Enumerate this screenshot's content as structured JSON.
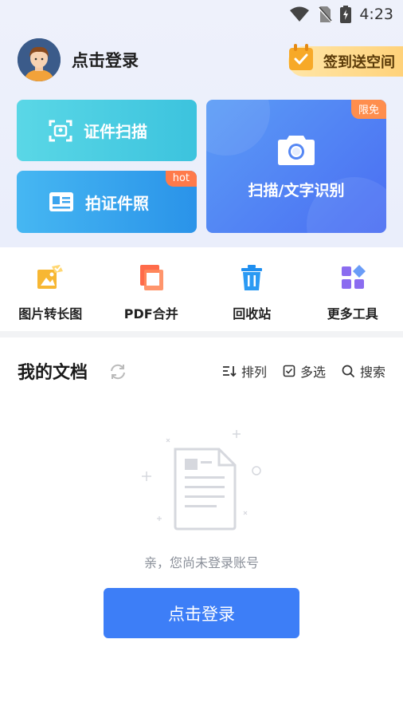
{
  "status_bar": {
    "time": "4:23"
  },
  "profile": {
    "login_label": "点击登录"
  },
  "checkin": {
    "label": "签到送空间"
  },
  "cards": {
    "id_scan": {
      "label": "证件扫描"
    },
    "id_photo": {
      "label": "拍证件照",
      "badge": "hot"
    },
    "ocr": {
      "label": "扫描/文字识别",
      "badge": "限免"
    }
  },
  "tools": [
    {
      "label": "图片转长图",
      "icon": "image-to-long-icon"
    },
    {
      "label": "PDF合并",
      "icon": "pdf-merge-icon"
    },
    {
      "label": "回收站",
      "icon": "trash-icon"
    },
    {
      "label": "更多工具",
      "icon": "more-tools-icon"
    }
  ],
  "documents": {
    "title": "我的文档",
    "actions": {
      "sort": "排列",
      "multi_select": "多选",
      "search": "搜索"
    },
    "empty_text": "亲，您尚未登录账号",
    "login_button": "点击登录"
  },
  "colors": {
    "primary": "#3d7ef7",
    "hot_badge": "#ff7a4a",
    "checkin": "#ffd27a"
  }
}
